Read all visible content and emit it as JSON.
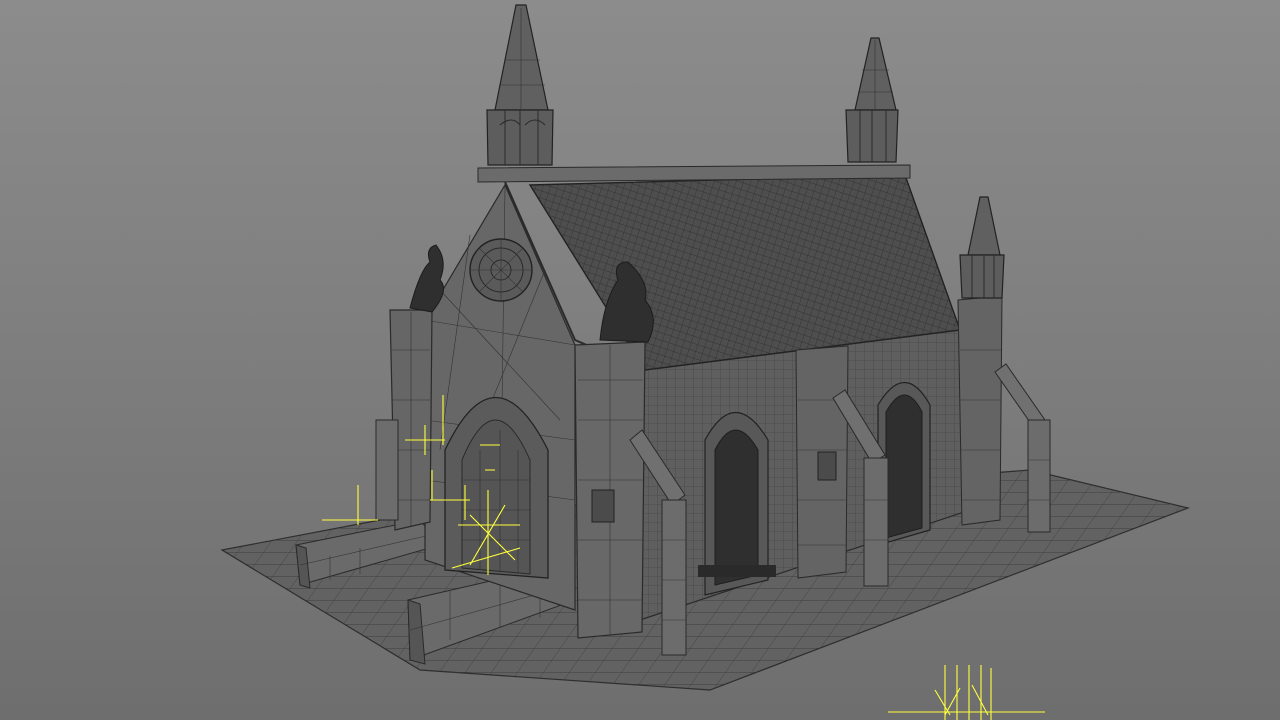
{
  "app": {
    "view": "3D viewport",
    "display_mode": "wireframe-on-shaded"
  },
  "scene": {
    "model": "gothic-chapel-mausoleum",
    "colors": {
      "background_top": "#8c8c8c",
      "background_bottom": "#6e6e6e",
      "mesh_surface": "#5e5e5e",
      "wireframe": "#2a2a2a",
      "selection_highlight": "#ffff3c"
    },
    "icons": [
      "spire-icon",
      "rose-window-icon",
      "gargoyle-icon",
      "locator-icon"
    ]
  }
}
